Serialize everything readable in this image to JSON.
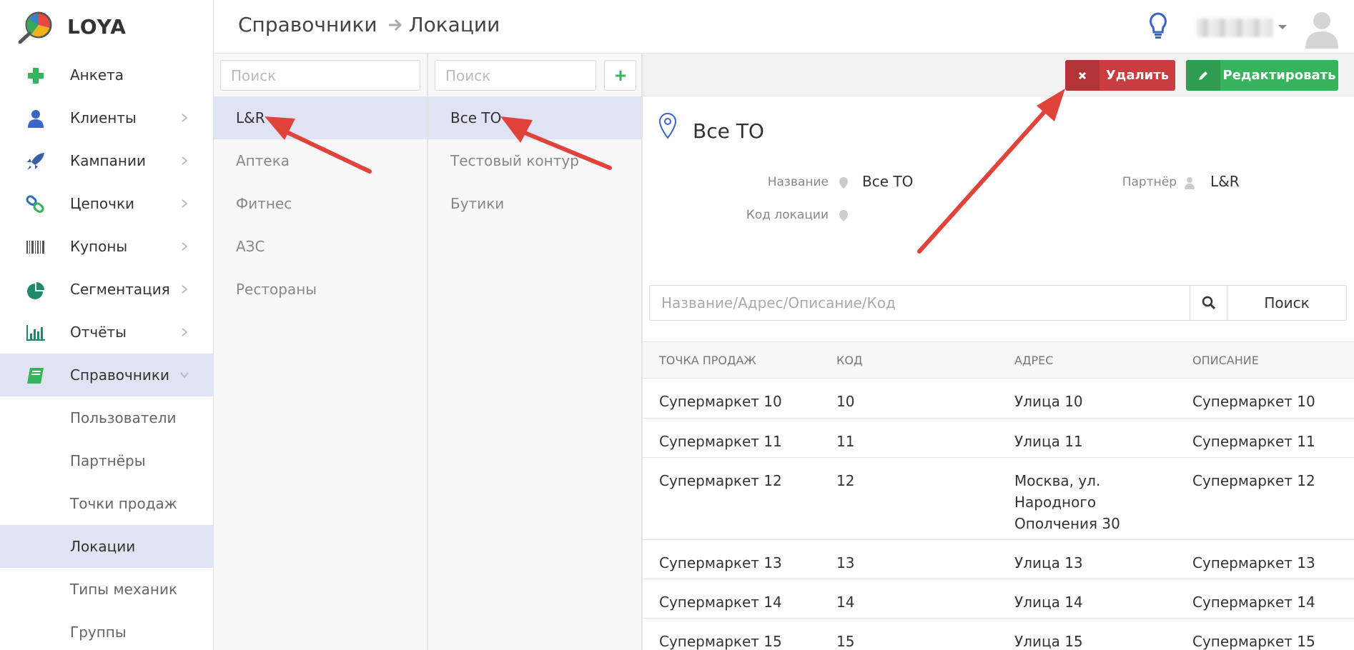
{
  "app": {
    "name": "LOYA"
  },
  "header": {
    "crumb1": "Справочники",
    "crumb2": "Локации"
  },
  "sidebar": {
    "items": [
      {
        "label": "Анкета"
      },
      {
        "label": "Клиенты"
      },
      {
        "label": "Кампании"
      },
      {
        "label": "Цепочки"
      },
      {
        "label": "Купоны"
      },
      {
        "label": "Сегментация"
      },
      {
        "label": "Отчёты"
      },
      {
        "label": "Справочники"
      }
    ],
    "subitems": [
      {
        "label": "Пользователи"
      },
      {
        "label": "Партнёры"
      },
      {
        "label": "Точки продаж"
      },
      {
        "label": "Локации"
      },
      {
        "label": "Типы механик"
      },
      {
        "label": "Группы"
      }
    ]
  },
  "partners": {
    "search_placeholder": "Поиск",
    "items": [
      "L&R",
      "Аптека",
      "Фитнес",
      "АЗС",
      "Рестораны"
    ]
  },
  "locations": {
    "search_placeholder": "Поиск",
    "items": [
      "Все ТО",
      "Тестовый контур",
      "Бутики"
    ]
  },
  "detail": {
    "delete_label": "Удалить",
    "edit_label": "Редактировать",
    "title": "Все ТО",
    "name_label": "Название",
    "name_value": "Все ТО",
    "code_label": "Код локации",
    "partner_label": "Партнёр",
    "partner_value": "L&R",
    "search_placeholder": "Название/Адрес/Описание/Код",
    "search_button": "Поиск"
  },
  "table": {
    "headers": [
      "Точка продаж",
      "Код",
      "Адрес",
      "Описание"
    ],
    "rows": [
      [
        "Супермаркет 10",
        "10",
        "Улица 10",
        "Супермаркет 10"
      ],
      [
        "Супермаркет 11",
        "11",
        "Улица 11",
        "Супермаркет 11"
      ],
      [
        "Супермаркет 12",
        "12",
        "Москва, ул. Народного Ополчения 30",
        "Супермаркет 12"
      ],
      [
        "Супермаркет 13",
        "13",
        "Улица 13",
        "Супермаркет 13"
      ],
      [
        "Супермаркет 14",
        "14",
        "Улица 14",
        "Супермаркет 14"
      ],
      [
        "Супермаркет 15",
        "15",
        "Улица 15",
        "Супермаркет 15"
      ]
    ]
  },
  "colors": {
    "accent_active": "#dfe3f3",
    "delete": "#cb3c3e",
    "edit": "#35b45c",
    "annotation_arrow": "#e0433a"
  }
}
